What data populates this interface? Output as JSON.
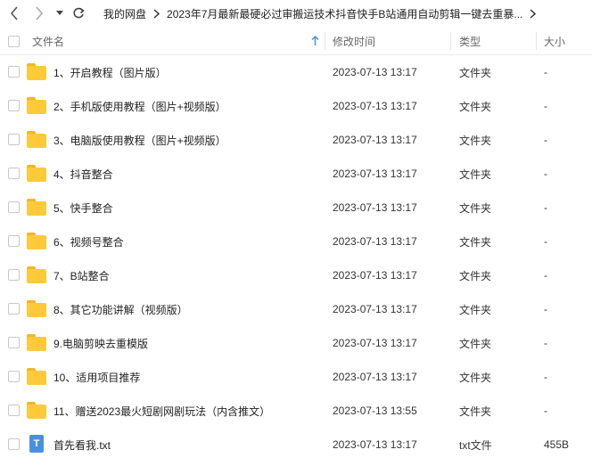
{
  "nav": {
    "breadcrumb": [
      "我的网盘",
      "2023年7月最新最硬必过审搬运技术抖音快手B站通用自动剪辑一键去重暴..."
    ]
  },
  "header": {
    "name": "文件名",
    "mtime": "修改时间",
    "type": "类型",
    "size": "大小"
  },
  "files": [
    {
      "name": "1、开启教程（图片版）",
      "mtime": "2023-07-13 13:17",
      "type": "文件夹",
      "size": "-",
      "icon": "folder-icon"
    },
    {
      "name": "2、手机版使用教程（图片+视频版）",
      "mtime": "2023-07-13 13:17",
      "type": "文件夹",
      "size": "-",
      "icon": "folder-icon"
    },
    {
      "name": "3、电脑版使用教程（图片+视频版）",
      "mtime": "2023-07-13 13:17",
      "type": "文件夹",
      "size": "-",
      "icon": "folder-icon"
    },
    {
      "name": "4、抖音整合",
      "mtime": "2023-07-13 13:17",
      "type": "文件夹",
      "size": "-",
      "icon": "folder-icon"
    },
    {
      "name": "5、快手整合",
      "mtime": "2023-07-13 13:17",
      "type": "文件夹",
      "size": "-",
      "icon": "folder-icon"
    },
    {
      "name": "6、视频号整合",
      "mtime": "2023-07-13 13:17",
      "type": "文件夹",
      "size": "-",
      "icon": "folder-icon"
    },
    {
      "name": "7、B站整合",
      "mtime": "2023-07-13 13:17",
      "type": "文件夹",
      "size": "-",
      "icon": "folder-icon"
    },
    {
      "name": "8、其它功能讲解（视频版）",
      "mtime": "2023-07-13 13:17",
      "type": "文件夹",
      "size": "-",
      "icon": "folder-icon"
    },
    {
      "name": "9.电脑剪映去重模版",
      "mtime": "2023-07-13 13:17",
      "type": "文件夹",
      "size": "-",
      "icon": "folder-icon"
    },
    {
      "name": "10、适用项目推荐",
      "mtime": "2023-07-13 13:17",
      "type": "文件夹",
      "size": "-",
      "icon": "folder-icon"
    },
    {
      "name": "11、赠送2023最火短剧网剧玩法（内含推文）",
      "mtime": "2023-07-13 13:55",
      "type": "文件夹",
      "size": "-",
      "icon": "folder-icon"
    },
    {
      "name": "首先看我.txt",
      "mtime": "2023-07-13 13:17",
      "type": "txt文件",
      "size": "455B",
      "icon": "txt-file-icon",
      "icon_letter": "T"
    }
  ]
}
